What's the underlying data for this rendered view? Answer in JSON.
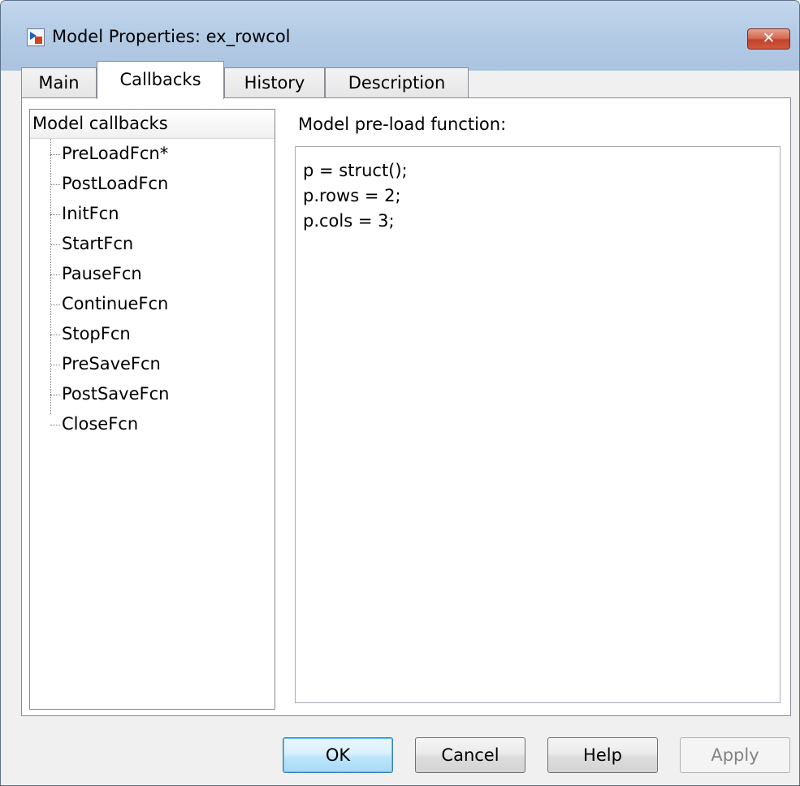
{
  "window": {
    "title": "Model Properties: ex_rowcol",
    "close_label": "✕"
  },
  "tabs": [
    {
      "label": "Main",
      "active": false
    },
    {
      "label": "Callbacks",
      "active": true
    },
    {
      "label": "History",
      "active": false
    },
    {
      "label": "Description",
      "active": false
    }
  ],
  "callbacks": {
    "header": "Model callbacks",
    "items": [
      {
        "label": "PreLoadFcn*"
      },
      {
        "label": "PostLoadFcn"
      },
      {
        "label": "InitFcn"
      },
      {
        "label": "StartFcn"
      },
      {
        "label": "PauseFcn"
      },
      {
        "label": "ContinueFcn"
      },
      {
        "label": "StopFcn"
      },
      {
        "label": "PreSaveFcn"
      },
      {
        "label": "PostSaveFcn"
      },
      {
        "label": "CloseFcn"
      }
    ]
  },
  "editor": {
    "label": "Model pre-load function:",
    "lines": [
      "p = struct();",
      "p.rows = 2;",
      "p.cols = 3;"
    ]
  },
  "buttons": {
    "ok": "OK",
    "cancel": "Cancel",
    "help": "Help",
    "apply": "Apply"
  },
  "colors": {
    "title_bar": "#b5cce6",
    "close_button": "#c2412a",
    "default_button": "#bee6fd"
  },
  "icons": {
    "app": "simulink-model-icon",
    "close": "close-icon"
  }
}
